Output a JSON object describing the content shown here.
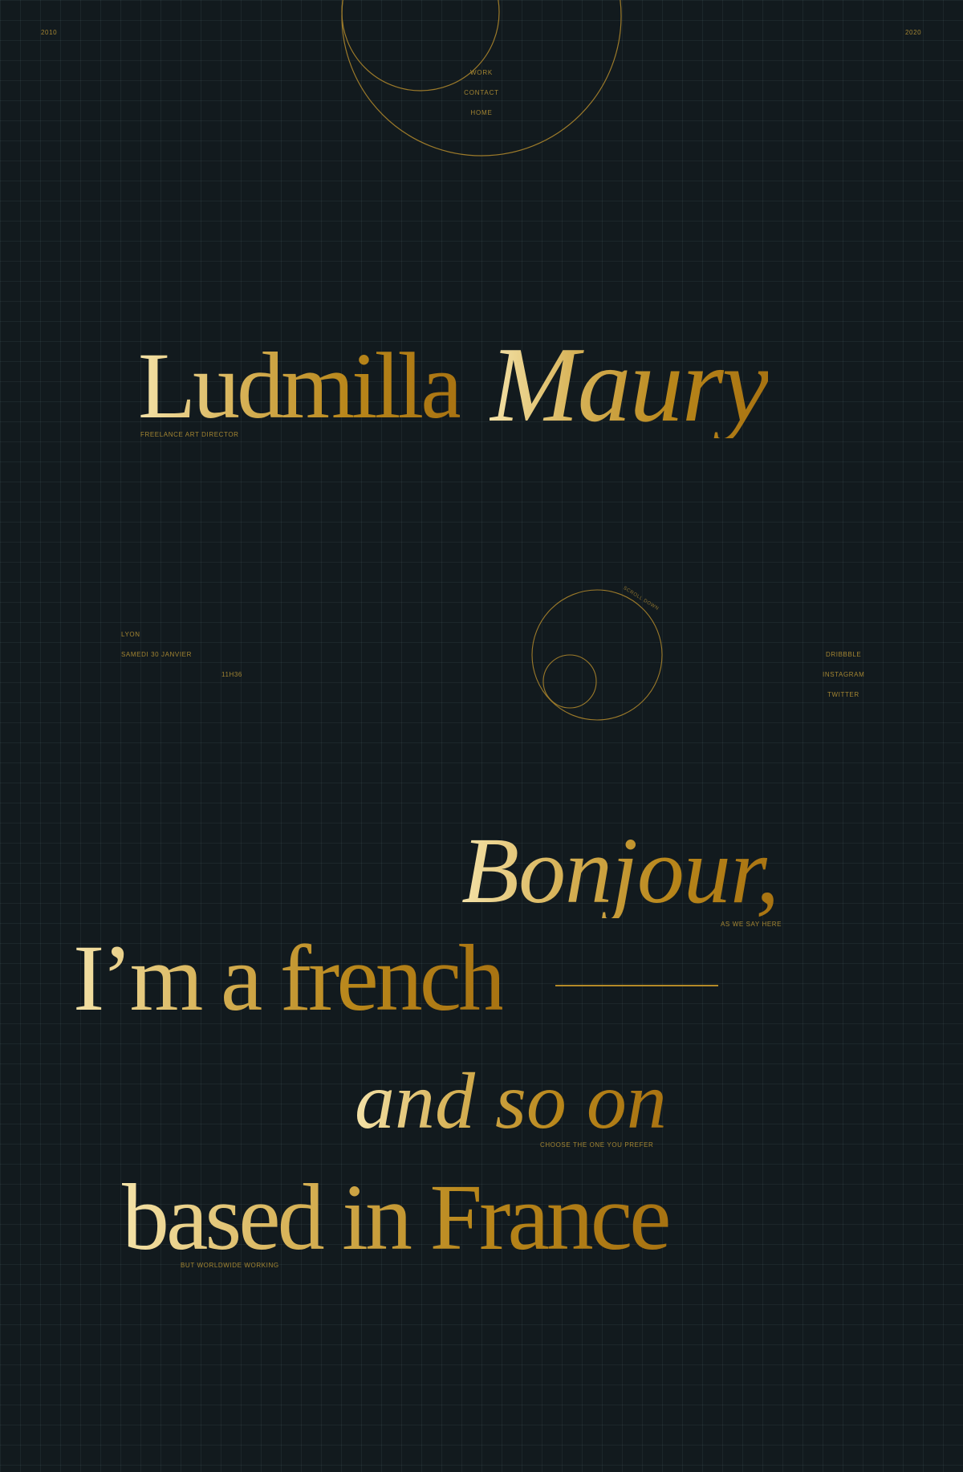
{
  "header": {
    "year_start": "2010",
    "year_end": "2020",
    "nav": [
      "WORK",
      "CONTACT",
      "HOME"
    ]
  },
  "hero": {
    "first_name": "Ludmilla",
    "last_name": "Maury",
    "role": "FREELANCE ART DIRECTOR"
  },
  "info": {
    "city": "LYON",
    "date": "SAMEDI 30 JANVIER",
    "time": "11H36",
    "scroll_label": "SCROLL DOWN",
    "social": [
      "DRIBBBLE",
      "INSTAGRAM",
      "TWITTER"
    ]
  },
  "intro": {
    "greeting": "Bonjour,",
    "greeting_note": "AS WE SAY HERE",
    "line1": "I’m a french",
    "line2": "and so on",
    "line2_note": "CHOOSE THE ONE YOU PREFER",
    "line3": "based in France",
    "line3_note": "BUT WORLDWIDE WORKING"
  },
  "colors": {
    "background": "#121a1e",
    "gold": "#b8861a",
    "gold_light": "#f4e2a8"
  }
}
